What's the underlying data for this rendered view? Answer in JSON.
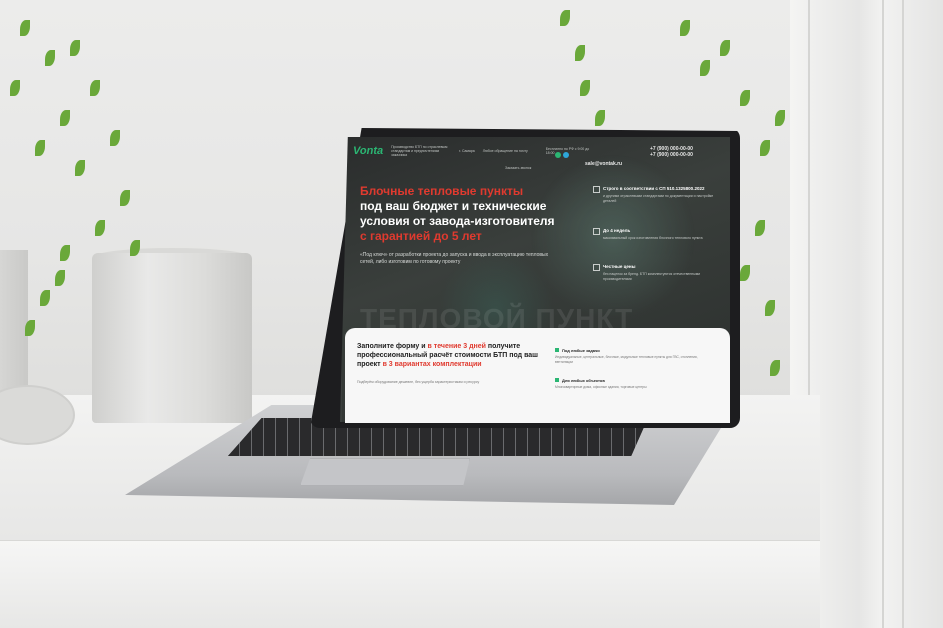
{
  "site": {
    "logo": "Vonta",
    "header_desc": "Производство БТП по отраслевым стандартам и предпочтениям заказчика",
    "location": "г. Самара",
    "callback_label": "Заказать звонок",
    "email_label": "Любое обращение на почту",
    "email": "sale@vontak.ru",
    "phone_label": "Бесплатно по РФ с 9:00 до 18:00",
    "phone_1": "+7 (900) 000-00-00",
    "phone_2": "+7 (900) 000-00-00",
    "hero": {
      "line_red": "Блочные тепловые пункты",
      "line_white": "под ваш бюджет и технические условия от завода-изготовителя",
      "line_red_2": "с гарантией до 5 лет",
      "subtitle": "«Под ключ» от разработки проекта до запуска и ввода в эксплуатацию тепловых сетей, либо изготовим по готовому проекту"
    },
    "watermark": "ТЕПЛОВОЙ ПУНКТ",
    "features": [
      {
        "title": "Строго в соответствии с СП 510.1325800.2022",
        "desc": "и другими отраслевыми стандартами по документации и настройке деталей"
      },
      {
        "title": "До 4 недель",
        "desc": "максимальный срок изготовления блочного теплового пункта"
      },
      {
        "title": "Честные цены",
        "desc": "без наценок за бренд. БТП комплектуются отечественными производителями"
      }
    ],
    "form": {
      "title_start": "Заполните форму и",
      "title_red": "в течение 3 дней",
      "title_mid": "получите профессиональный расчёт стоимости БТП под ваш проект",
      "title_red_2": "в 3 вариантах комплектации",
      "subtitle": "Подберём оборудование дешевле, без ущерба характеристикам и ресурсу"
    },
    "bullets": [
      {
        "title": "Под любые задачи",
        "desc": "Индивидуальные, центральные, блочные, модульные тепловые пункты для ГВС, отопления, вентиляции"
      },
      {
        "title": "Для любых объектов",
        "desc": "Многоквартирные дома, офисные здания, торговые центры"
      }
    ]
  },
  "colors": {
    "accent_red": "#e03a2f",
    "brand_green": "#2bb673"
  }
}
